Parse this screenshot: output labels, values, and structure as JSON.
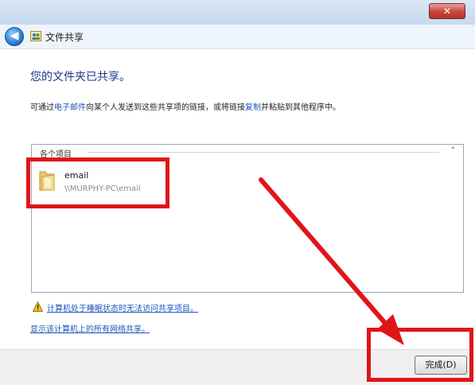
{
  "window": {
    "title": "文件共享",
    "close_symbol": "✕"
  },
  "nav": {
    "back_symbol": "◀"
  },
  "content": {
    "heading": "您的文件夹已共享。",
    "desc_prefix": "可通过",
    "desc_email_link": "电子邮件",
    "desc_middle": "向某个人发送到这些共享项的链接，或将链接",
    "desc_copy_link": "复制",
    "desc_suffix": "并粘贴到其他程序中。"
  },
  "shared_items": {
    "group_title": "各个项目",
    "collapse_symbol": "˄",
    "items": [
      {
        "name": "email",
        "path": "\\\\MURPHY-PC\\email"
      }
    ]
  },
  "links": {
    "sleep_warning": "计算机处于睡眠状态时无法访问共享项目。",
    "show_network_shares": "显示该计算机上的所有网络共享。"
  },
  "footer": {
    "finish_label": "完成(D)"
  },
  "colors": {
    "annotation": "#e0151a",
    "link": "#1a56b8",
    "heading": "#1c3a8c"
  },
  "icons": [
    "back-arrow-icon",
    "share-icon",
    "folder-icon",
    "warning-icon",
    "close-icon"
  ]
}
